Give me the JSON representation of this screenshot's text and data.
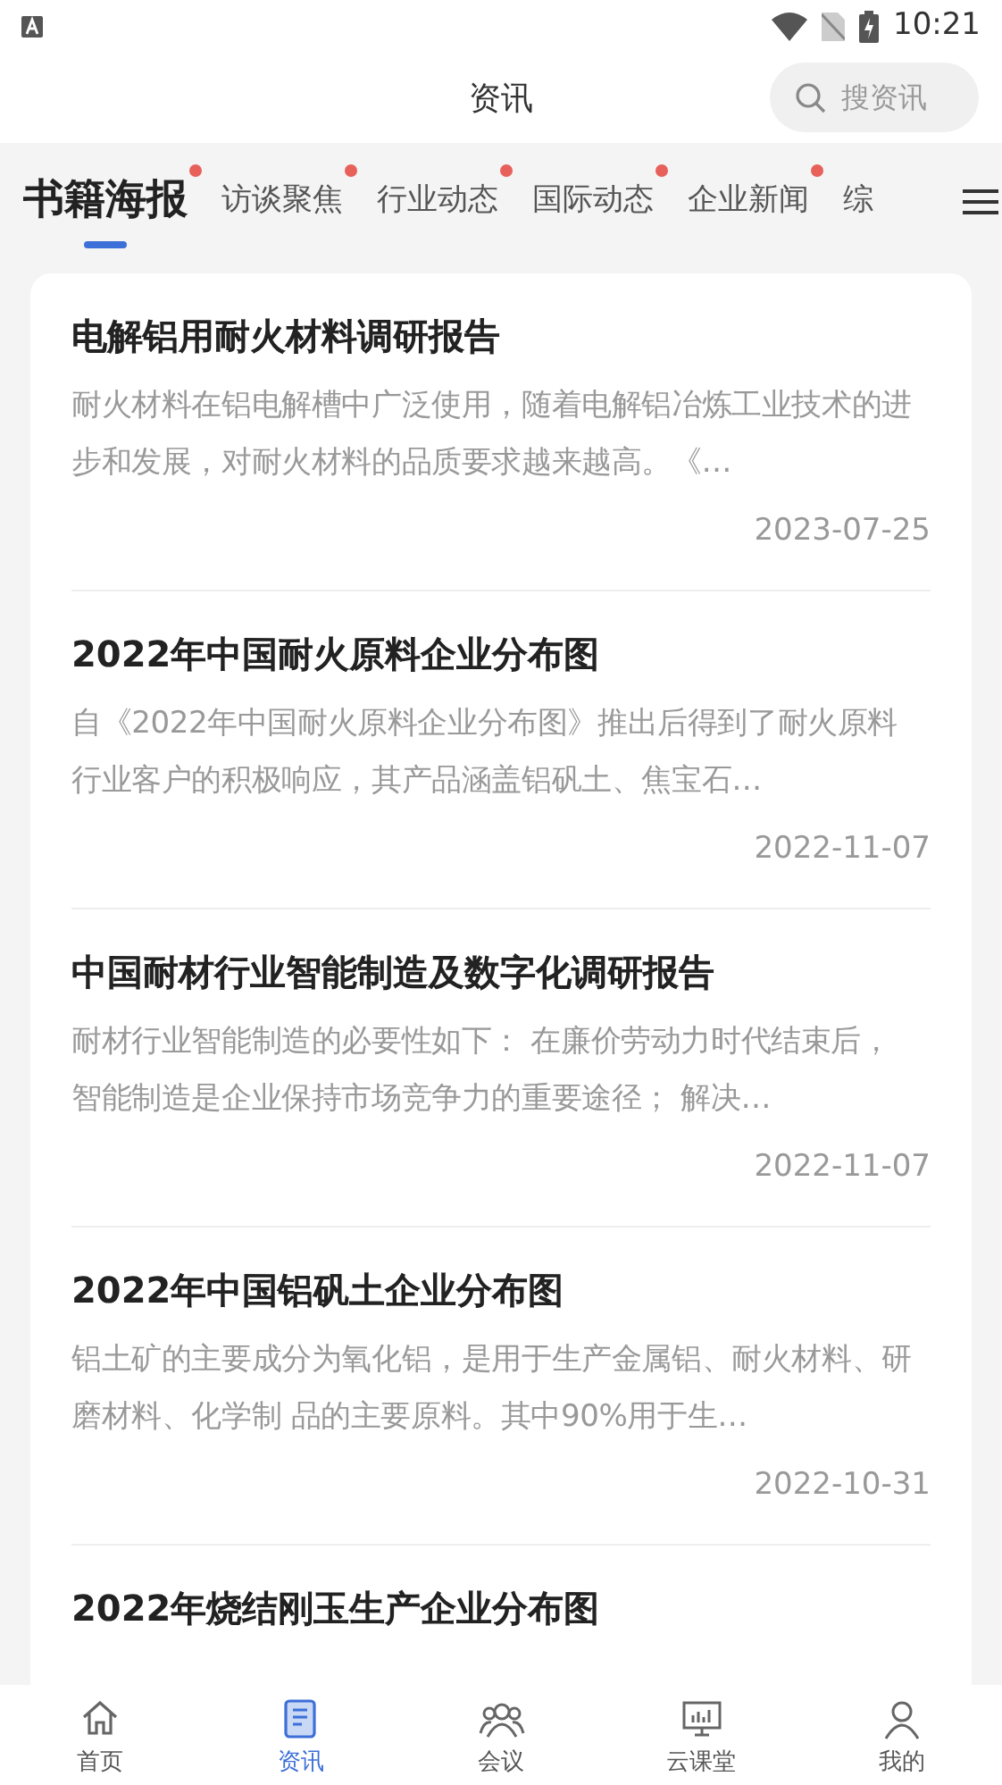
{
  "status_bar": {
    "time": "10:21"
  },
  "header": {
    "title": "资讯",
    "search": {
      "placeholder": "搜资讯"
    }
  },
  "tabs": [
    {
      "label": "书籍海报",
      "selected": true,
      "dot": true
    },
    {
      "label": "访谈聚焦",
      "selected": false,
      "dot": true
    },
    {
      "label": "行业动态",
      "selected": false,
      "dot": true
    },
    {
      "label": "国际动态",
      "selected": false,
      "dot": true
    },
    {
      "label": "企业新闻",
      "selected": false,
      "dot": true
    },
    {
      "label": "综",
      "selected": false,
      "dot": false
    }
  ],
  "articles": [
    {
      "title": "电解铝用耐火材料调研报告",
      "summary": "耐火材料在铝电解槽中广泛使用，随着电解铝冶炼工业技术的进步和发展，对耐火材料的品质要求越来越高。《…",
      "date": "2023-07-25"
    },
    {
      "title": "2022年中国耐火原料企业分布图",
      "summary": "自《2022年中国耐火原料企业分布图》推出后得到了耐火原料行业客户的积极响应，其产品涵盖铝矾土、焦宝石…",
      "date": "2022-11-07"
    },
    {
      "title": "中国耐材行业智能制造及数字化调研报告",
      "summary": "耐材行业智能制造的必要性如下： 在廉价劳动力时代结束后，智能制造是企业保持市场竞争力的重要途径； 解决…",
      "date": "2022-11-07"
    },
    {
      "title": "2022年中国铝矾土企业分布图",
      "summary": "铝土矿的主要成分为氧化铝，是用于生产金属铝、耐火材料、研磨材料、化学制 品的主要原料。其中90%用于生…",
      "date": "2022-10-31"
    },
    {
      "title": "2022年烧结刚玉生产企业分布图"
    }
  ],
  "bottom_nav": [
    {
      "label": "首页",
      "kind": "home",
      "selected": false
    },
    {
      "label": "资讯",
      "kind": "news",
      "selected": true
    },
    {
      "label": "会议",
      "kind": "meeting",
      "selected": false
    },
    {
      "label": "云课堂",
      "kind": "course",
      "selected": false
    },
    {
      "label": "我的",
      "kind": "profile",
      "selected": false
    }
  ]
}
